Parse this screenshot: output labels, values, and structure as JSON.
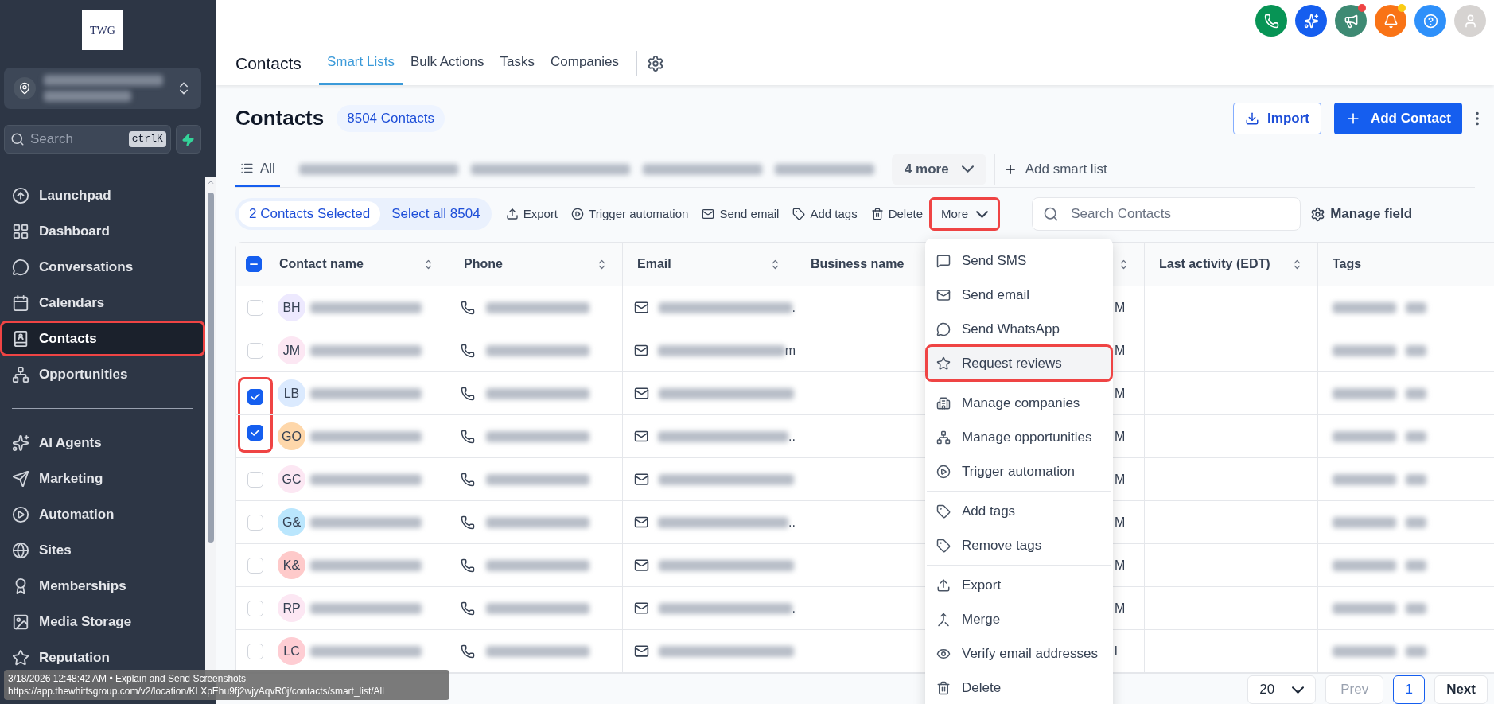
{
  "topbar": {
    "icons": [
      {
        "kind": "phone",
        "color": "#079455",
        "dot": false
      },
      {
        "kind": "sparkle",
        "color": "#155eef",
        "dot": false
      },
      {
        "kind": "megaphone",
        "color": "#3e8a73",
        "dot": true
      },
      {
        "kind": "bell",
        "color": "#f97316",
        "dot": true
      },
      {
        "kind": "help",
        "color": "#2e90fa",
        "dot": false
      },
      {
        "kind": "avatar",
        "color": "#d6d3d1",
        "dot": false
      }
    ]
  },
  "sidebar": {
    "logo": "TWG",
    "search": {
      "placeholder": "Search",
      "shortcut": "ctrlK"
    },
    "items": [
      {
        "label": "Launchpad",
        "kind": "launch",
        "selected": false,
        "highlighted": false
      },
      {
        "label": "Dashboard",
        "kind": "grid",
        "selected": false,
        "highlighted": false
      },
      {
        "label": "Conversations",
        "kind": "chat",
        "selected": false,
        "highlighted": false
      },
      {
        "label": "Calendars",
        "kind": "calendar",
        "selected": false,
        "highlighted": false
      },
      {
        "label": "Contacts",
        "kind": "contacts",
        "selected": true,
        "highlighted": true
      },
      {
        "label": "Opportunities",
        "kind": "network",
        "selected": false,
        "highlighted": false
      }
    ],
    "more_items": [
      {
        "label": "AI Agents",
        "kind": "sparkle",
        "selected": false,
        "highlighted": false
      },
      {
        "label": "Marketing",
        "kind": "send",
        "selected": false,
        "highlighted": false
      },
      {
        "label": "Automation",
        "kind": "play",
        "selected": false,
        "highlighted": false
      },
      {
        "label": "Sites",
        "kind": "globe",
        "selected": false,
        "highlighted": false
      },
      {
        "label": "Memberships",
        "kind": "award",
        "selected": false,
        "highlighted": false
      },
      {
        "label": "Media Storage",
        "kind": "image",
        "selected": false,
        "highlighted": false
      },
      {
        "label": "Reputation",
        "kind": "star",
        "selected": false,
        "highlighted": false
      }
    ]
  },
  "header": {
    "title": "Contacts",
    "tabs": [
      {
        "label": "Smart Lists",
        "selected": true
      },
      {
        "label": "Bulk Actions",
        "selected": false
      },
      {
        "label": "Tasks",
        "selected": false
      },
      {
        "label": "Companies",
        "selected": false
      }
    ]
  },
  "page": {
    "title": "Contacts",
    "count": "8504 Contacts",
    "import_button": "Import",
    "add_button": "Add Contact"
  },
  "smart_lists": {
    "tabs": [
      {
        "label": "All",
        "selected": true
      }
    ],
    "more": "4 more",
    "add": "Add smart list"
  },
  "actions": {
    "selected": "2 Contacts Selected",
    "select_all": "Select all 8504",
    "items": [
      {
        "label": "Export",
        "kind": "upload"
      },
      {
        "label": "Trigger automation",
        "kind": "play"
      },
      {
        "label": "Send email",
        "kind": "mail"
      },
      {
        "label": "Add tags",
        "kind": "tag"
      },
      {
        "label": "Delete",
        "kind": "trash"
      }
    ],
    "more": {
      "label": "More",
      "highlighted": true
    },
    "search": {
      "placeholder": "Search Contacts"
    },
    "manage_fields": "Manage field"
  },
  "table": {
    "select_all": {
      "indeterminate": true
    },
    "columns": [
      {
        "label": "Contact name",
        "sortable": true
      },
      {
        "label": "Phone",
        "sortable": true
      },
      {
        "label": "Email",
        "sortable": true
      },
      {
        "label": "Business name",
        "sortable": false
      },
      {
        "sortable": true
      },
      {
        "label": "Last activity (EDT)",
        "sortable": true
      },
      {
        "label": "Tags",
        "sortable": false
      }
    ],
    "rows": [
      {
        "initials": "BH",
        "color": "#ede9fe",
        "checked": false,
        "highlighted": false,
        "email_tail": ".",
        "column_5": "M"
      },
      {
        "initials": "JM",
        "color": "#fce7f3",
        "checked": false,
        "highlighted": false,
        "email_tail": "m",
        "column_5": "M"
      },
      {
        "initials": "LB",
        "color": "#dbeafe",
        "checked": true,
        "highlighted": true,
        "column_5": "M"
      },
      {
        "initials": "GO",
        "color": "#fed7aa",
        "checked": true,
        "highlighted": true,
        "email_tail": "..",
        "column_5": "M"
      },
      {
        "initials": "GC",
        "color": "#fce7f3",
        "checked": false,
        "highlighted": false,
        "column_5": "M"
      },
      {
        "initials": "G&",
        "color": "#bae6fd",
        "checked": false,
        "highlighted": false,
        "email_tail": "..",
        "column_5": "M"
      },
      {
        "initials": "K&",
        "color": "#fecaca",
        "checked": false,
        "highlighted": false,
        "column_5": "M"
      },
      {
        "initials": "RP",
        "color": "#fce7f3",
        "checked": false,
        "highlighted": false,
        "email_tail": ".",
        "column_5": "M"
      },
      {
        "initials": "LC",
        "color": "#fecdd3",
        "checked": false,
        "highlighted": false,
        "column_5": "l"
      }
    ]
  },
  "pagination": {
    "page_size": "20",
    "prev": {
      "label": "Prev",
      "disabled": true
    },
    "pages": [
      {
        "label": "1",
        "selected": true
      }
    ],
    "next": {
      "label": "Next",
      "disabled": false
    }
  },
  "menu": {
    "groups": [
      [
        {
          "label": "Send SMS",
          "kind": "sms",
          "selected": false
        },
        {
          "label": "Send email",
          "kind": "mail",
          "selected": false
        },
        {
          "label": "Send WhatsApp",
          "kind": "chat",
          "selected": false
        },
        {
          "label": "Request reviews",
          "kind": "star",
          "selected": true
        }
      ],
      [
        {
          "label": "Manage companies",
          "kind": "building",
          "selected": false
        },
        {
          "label": "Manage opportunities",
          "kind": "network",
          "selected": false
        },
        {
          "label": "Trigger automation",
          "kind": "play",
          "selected": false
        }
      ],
      [
        {
          "label": "Add tags",
          "kind": "tag",
          "selected": false
        },
        {
          "label": "Remove tags",
          "kind": "tag",
          "selected": false
        }
      ],
      [
        {
          "label": "Export",
          "kind": "upload",
          "selected": false
        },
        {
          "label": "Merge",
          "kind": "merge",
          "selected": false
        },
        {
          "label": "Verify email addresses",
          "kind": "eye",
          "selected": false
        },
        {
          "label": "Delete",
          "kind": "trash",
          "selected": false
        }
      ]
    ]
  },
  "tooltip": {
    "line_1": "3/18/2026 12:48:42 AM • Explain and Send Screenshots",
    "line_2": "https://app.thewhittsgroup.com/v2/location/KLXpEhu9fj2wjyAqvR0j/contacts/smart_list/All"
  }
}
